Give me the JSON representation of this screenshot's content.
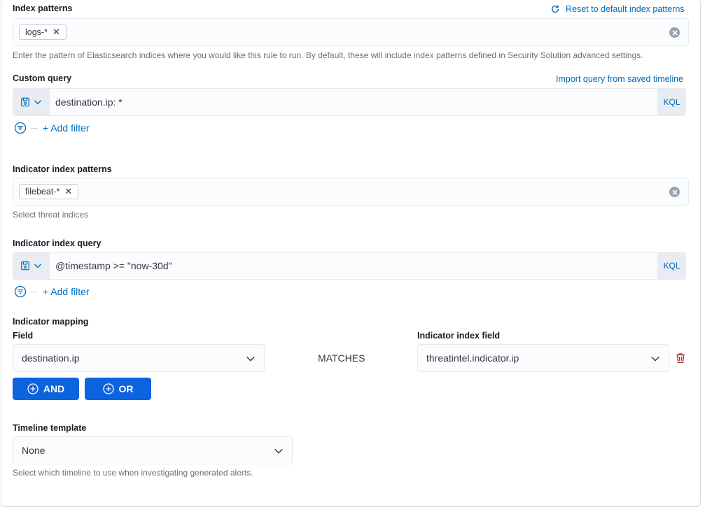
{
  "index_patterns": {
    "label": "Index patterns",
    "reset_link": "Reset to default index patterns",
    "badge": "logs-*",
    "help": "Enter the pattern of Elasticsearch indices where you would like this rule to run. By default, these will include index patterns defined in Security Solution advanced settings."
  },
  "custom_query": {
    "label": "Custom query",
    "import_link": "Import query from saved timeline",
    "query": "destination.ip: *",
    "language": "KQL",
    "add_filter": "+ Add filter"
  },
  "indicator_index_patterns": {
    "label": "Indicator index patterns",
    "badge": "filebeat-*",
    "help": "Select threat indices"
  },
  "indicator_index_query": {
    "label": "Indicator index query",
    "query": "@timestamp >= \"now-30d\"",
    "language": "KQL",
    "add_filter": "+ Add filter"
  },
  "indicator_mapping": {
    "label": "Indicator mapping",
    "field_label": "Field",
    "field_value": "destination.ip",
    "operator": "MATCHES",
    "index_field_label": "Indicator index field",
    "index_field_value": "threatintel.indicator.ip",
    "and_label": "AND",
    "or_label": "OR"
  },
  "timeline_template": {
    "label": "Timeline template",
    "value": "None",
    "help": "Select which timeline to use when investigating generated alerts."
  },
  "icons": {
    "refresh": "refresh-icon",
    "clear": "clear-icon",
    "save": "save-query-icon",
    "chevron": "chevron-down-icon",
    "filter": "filter-icon",
    "trash": "trash-icon",
    "plus_circle": "plus-circle-icon"
  },
  "colors": {
    "link": "#006bb8",
    "primary_button": "#0b64dd",
    "danger": "#bd271e"
  }
}
